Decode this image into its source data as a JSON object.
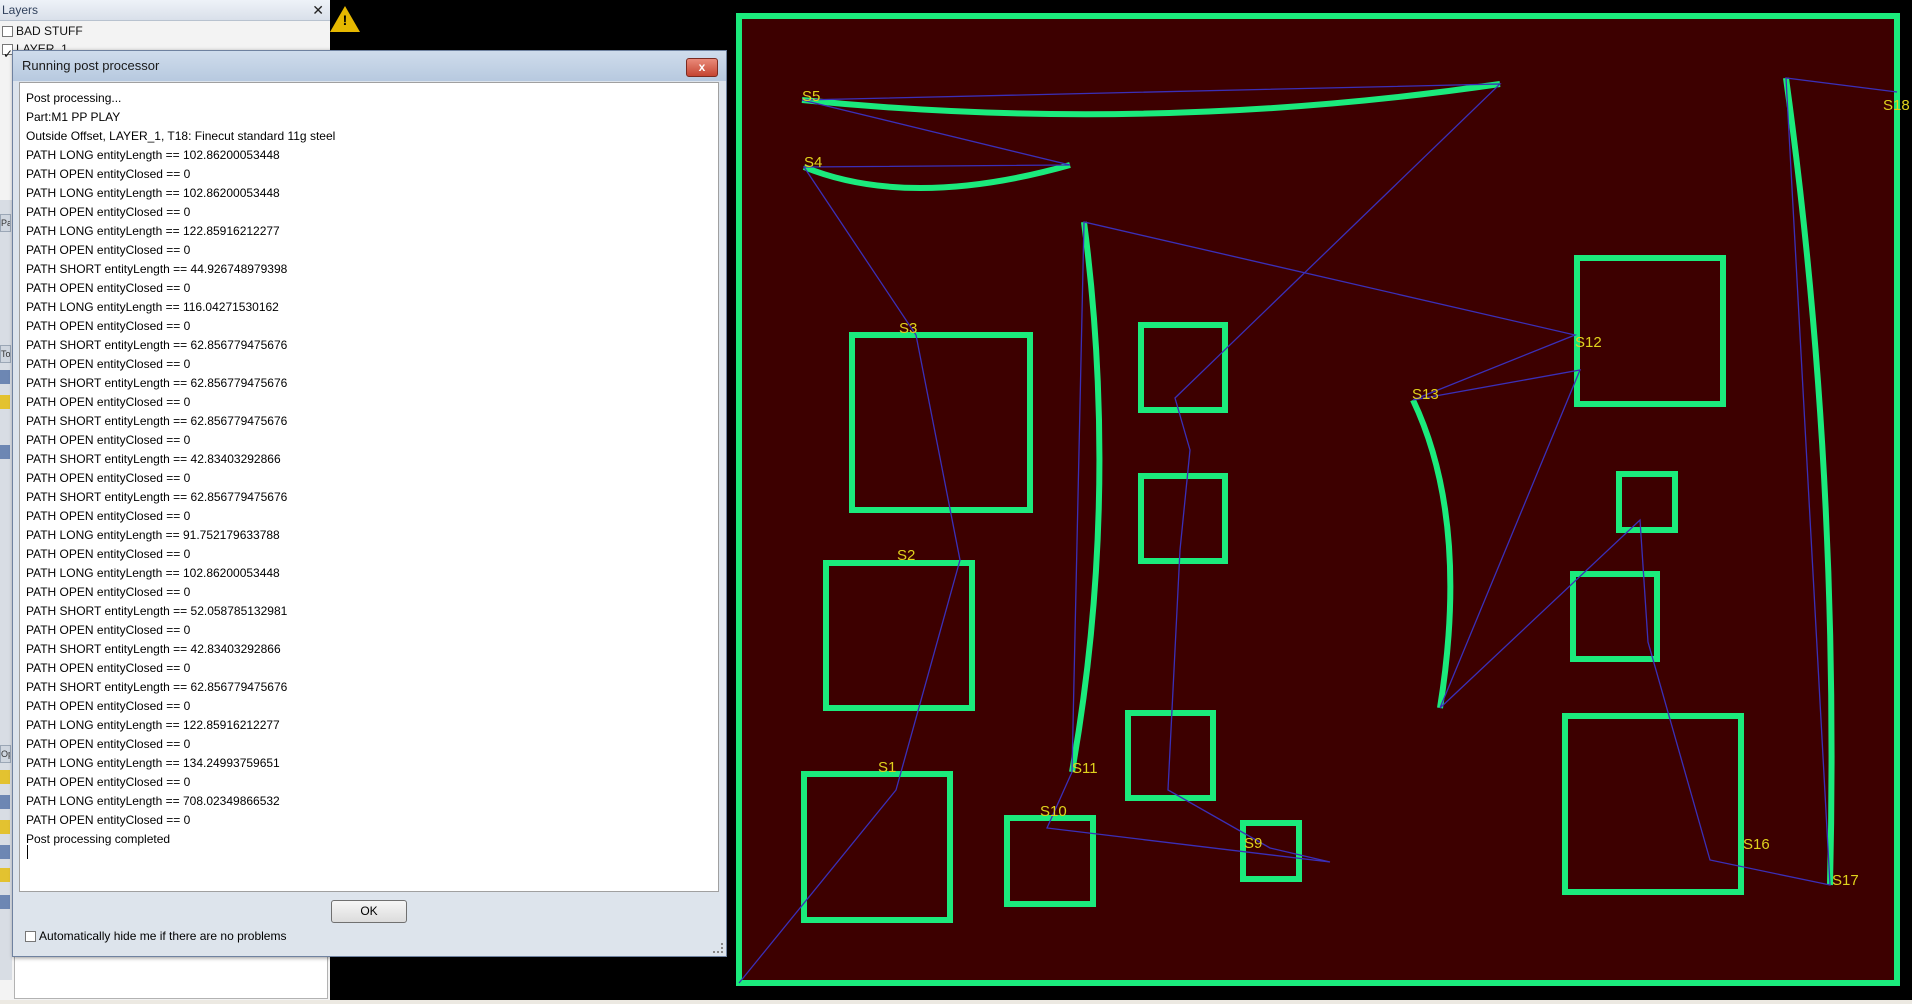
{
  "layers_panel": {
    "title": "Layers",
    "close_glyph": "✕",
    "items": [
      {
        "label": "BAD STUFF",
        "checked": false
      },
      {
        "label": "LAYER_1",
        "checked": true
      }
    ],
    "side_tabs": [
      "Par",
      "Too",
      "Op"
    ]
  },
  "toolbar": {
    "warning_icon": "warning-icon",
    "warning_glyph": "!"
  },
  "canvas": {
    "background": "#3d0000",
    "outline_color": "#1bea7c",
    "path_color": "#3b2fb8",
    "label_color": "#e0d21d",
    "labels": [
      "S1",
      "S2",
      "S3",
      "S4",
      "S5",
      "S10",
      "S11",
      "S12",
      "S13",
      "S16",
      "S17",
      "S18",
      "S9"
    ]
  },
  "dialog": {
    "title": "Running post processor",
    "close_glyph": "x",
    "log_lines": [
      "Post processing...",
      "Part:M1 PP PLAY",
      "Outside Offset, LAYER_1, T18: Finecut standard 11g steel",
      "PATH LONG entityLength == 102.86200053448",
      "PATH OPEN entityClosed == 0",
      "PATH LONG entityLength == 102.86200053448",
      "PATH OPEN entityClosed == 0",
      "PATH LONG entityLength == 122.85916212277",
      "PATH OPEN entityClosed == 0",
      "PATH SHORT entityLength == 44.926748979398",
      "PATH OPEN entityClosed == 0",
      "PATH LONG entityLength == 116.04271530162",
      "PATH OPEN entityClosed == 0",
      "PATH SHORT entityLength == 62.856779475676",
      "PATH OPEN entityClosed == 0",
      "PATH SHORT entityLength == 62.856779475676",
      "PATH OPEN entityClosed == 0",
      "PATH SHORT entityLength == 62.856779475676",
      "PATH OPEN entityClosed == 0",
      "PATH SHORT entityLength == 42.83403292866",
      "PATH OPEN entityClosed == 0",
      "PATH SHORT entityLength == 62.856779475676",
      "PATH OPEN entityClosed == 0",
      "PATH LONG entityLength == 91.752179633788",
      "PATH OPEN entityClosed == 0",
      "PATH LONG entityLength == 102.86200053448",
      "PATH OPEN entityClosed == 0",
      "PATH SHORT entityLength == 52.058785132981",
      "PATH OPEN entityClosed == 0",
      "PATH SHORT entityLength == 42.83403292866",
      "PATH OPEN entityClosed == 0",
      "PATH SHORT entityLength == 62.856779475676",
      "PATH OPEN entityClosed == 0",
      "PATH LONG entityLength == 122.85916212277",
      "PATH OPEN entityClosed == 0",
      "PATH LONG entityLength == 134.24993759651",
      "PATH OPEN entityClosed == 0",
      "PATH LONG entityLength == 708.02349866532",
      "PATH OPEN entityClosed == 0",
      "Post processing completed"
    ],
    "ok_label": "OK",
    "auto_hide_label": "Automatically hide me if there are no problems",
    "auto_hide_checked": false
  }
}
